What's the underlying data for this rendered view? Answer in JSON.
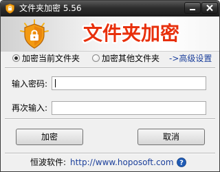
{
  "window": {
    "title": "文件夹加密 5.56"
  },
  "banner": {
    "title": "文件夹加密"
  },
  "options": {
    "encrypt_current": "加密当前文件夹",
    "encrypt_other": "加密其他文件夹",
    "selected": "encrypt_current",
    "advanced_link": "->高级设置"
  },
  "form": {
    "password_label": "输入密码:",
    "password_value": "",
    "confirm_label": "再次输入:",
    "confirm_value": ""
  },
  "buttons": {
    "encrypt": "加密",
    "cancel": "取消"
  },
  "footer": {
    "company_label": "恒波软件:",
    "website": "http://www.hoposoft.com"
  },
  "colors": {
    "titlebar": "#2e2e2e",
    "banner_text": "#e8300c",
    "link": "#1b3f9b",
    "help_icon": "#1f5bb5"
  }
}
